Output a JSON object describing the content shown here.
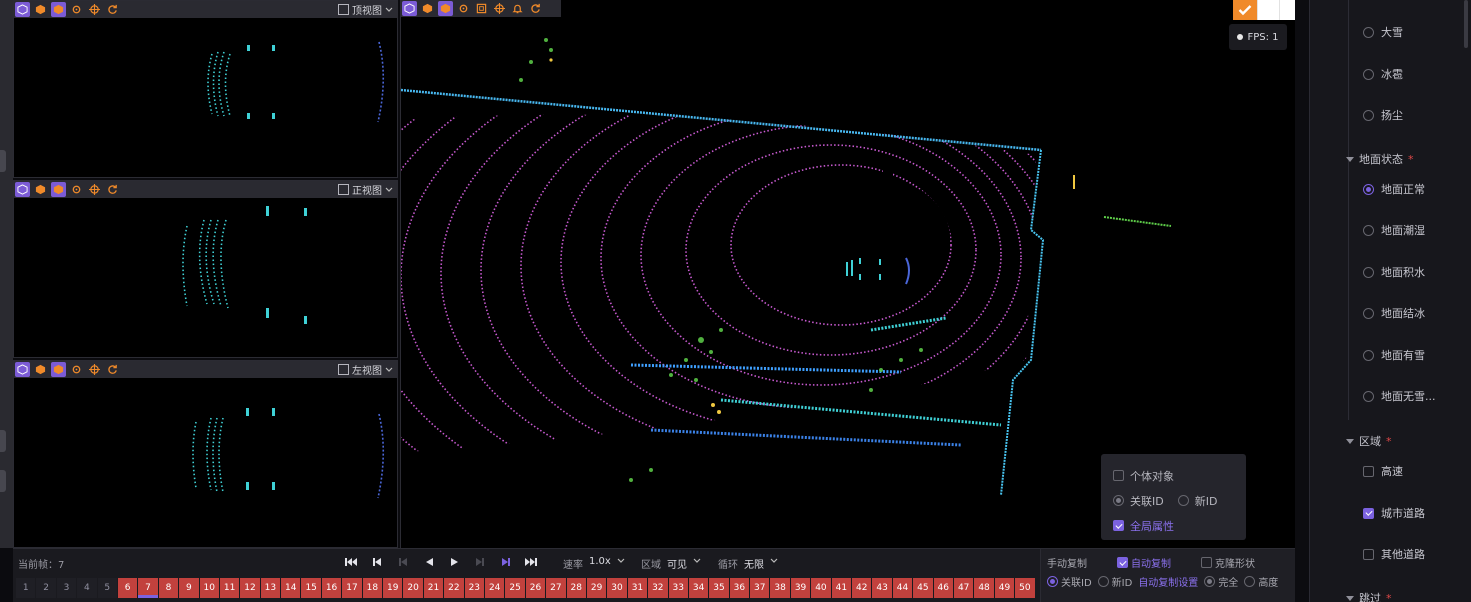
{
  "views": [
    {
      "name": "top",
      "label": "顶视图"
    },
    {
      "name": "front",
      "label": "正视图"
    },
    {
      "name": "left",
      "label": "左视图"
    }
  ],
  "fps_label": "FPS: 1",
  "popover": {
    "individual_object": "个体对象",
    "link_id": "关联ID",
    "new_id": "新ID",
    "global_attr": "全局属性"
  },
  "bottom": {
    "current_frame_label": "当前帧：7",
    "speed_label": "速率",
    "speed_value": "1.0x",
    "region_label": "区域",
    "region_value": "可见",
    "loop_label": "循环",
    "loop_value": "无限",
    "frames": [
      "1",
      "2",
      "3",
      "4",
      "5",
      "6",
      "7",
      "8",
      "9",
      "10",
      "11",
      "12",
      "13",
      "14",
      "15",
      "16",
      "17",
      "18",
      "19",
      "20",
      "21",
      "22",
      "23",
      "24",
      "25",
      "26",
      "27",
      "28",
      "29",
      "30",
      "31",
      "32",
      "33",
      "34",
      "35",
      "36",
      "37",
      "38",
      "39",
      "40",
      "41",
      "42",
      "43",
      "44",
      "45",
      "46",
      "47",
      "48",
      "49",
      "50"
    ],
    "labelled_from": 6,
    "current_frame": 7
  },
  "copy_panel": {
    "manual_copy": "手动复制",
    "auto_copy": "自动复制",
    "clone_shape": "克隆形状",
    "link_id": "关联ID",
    "new_id": "新ID",
    "auto_copy_settings": "自动复制设置",
    "full": "完全",
    "height": "高度"
  },
  "attributes": {
    "weather_options": [
      "大雪",
      "冰雹",
      "扬尘"
    ],
    "ground_state_label": "地面状态",
    "ground_state_options": [
      "地面正常",
      "地面潮湿",
      "地面积水",
      "地面结冰",
      "地面有雪",
      "地面无雪..."
    ],
    "region_label": "区域",
    "region_options": [
      "高速",
      "城市道路",
      "其他道路"
    ],
    "region_checked": "城市道路",
    "next_section_label": "跳过",
    "required_mark": "*"
  },
  "colors": {
    "accent": "#7b62e0",
    "frame_labelled": "#c2413d",
    "confirm": "#f08a2a"
  }
}
